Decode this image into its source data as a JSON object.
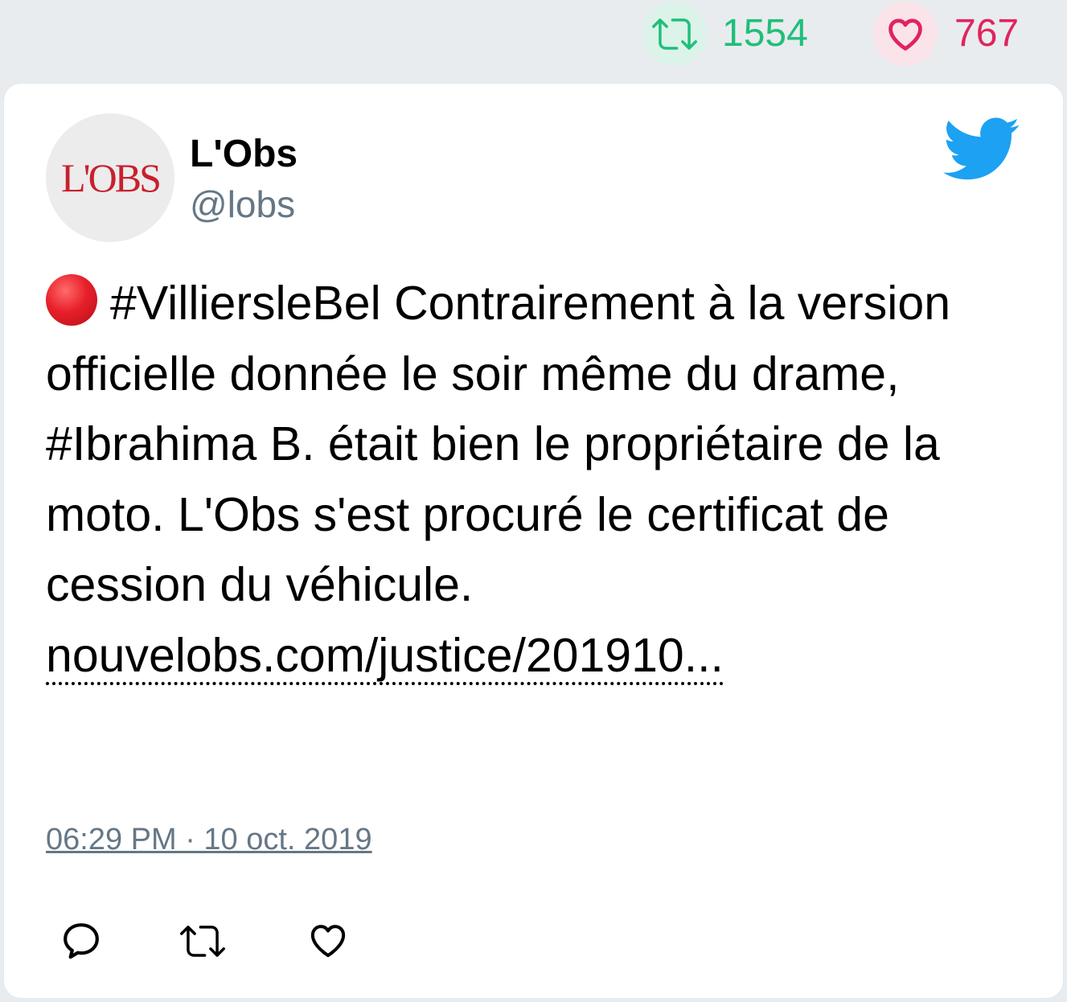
{
  "stats": {
    "retweet_count": "1554",
    "like_count": "767",
    "retweet_color": "#1fbf7a",
    "like_color": "#e0245e"
  },
  "tweet": {
    "author_name": "L'Obs",
    "author_handle": "@lobs",
    "avatar_text": "L'OBS",
    "text_emoji": "red-circle",
    "text_main": "#VilliersleBel Contrairement à la version officielle donnée le soir même du drame, #Ibrahima B. était bien le propriétaire de la moto. L'Obs s'est procuré le certificat de cession du véhicule.",
    "link": "nouvelobs.com/justice/201910...",
    "timestamp": "06:29 PM · 10 oct. 2019"
  },
  "icons": {
    "brand": "twitter-bird-icon",
    "actions": [
      "reply-icon",
      "retweet-icon",
      "like-icon"
    ]
  }
}
